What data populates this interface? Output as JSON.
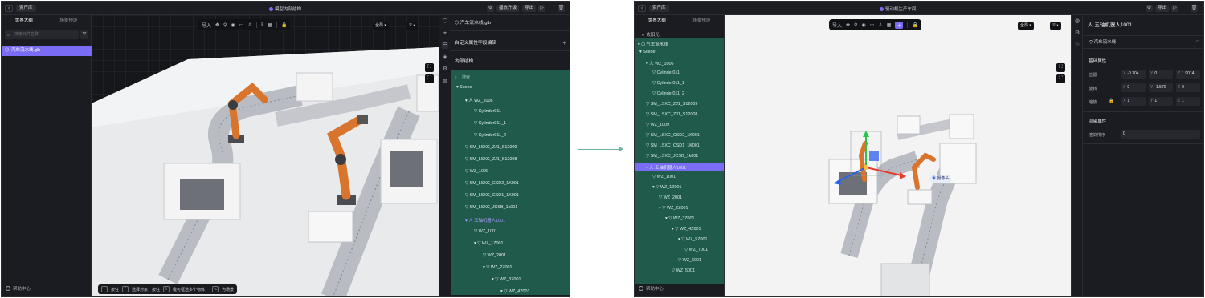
{
  "left": {
    "crumb": "资产库",
    "title": "模型内部结构",
    "top_buttons": [
      "播放升级",
      "导出"
    ],
    "tabs": [
      "世界大纲",
      "场景预设"
    ],
    "search_placeholder": "搜索元件名称",
    "file_item": "汽车流水线.glb",
    "help": "帮助中心",
    "floor_import": "导入",
    "view_mode": "全局",
    "panel_title": "汽车流水线.glb",
    "custom_attr": "自定义属性字段编辑",
    "inner_structure": "内部结构",
    "tree_search": "搜索",
    "tree": [
      {
        "label": "Scene",
        "indent": 0,
        "icon": "▾"
      },
      {
        "label": "WZ_1006",
        "indent": 1,
        "icon": "▾ 人"
      },
      {
        "label": "Cylinder011",
        "indent": 2,
        "icon": "▽"
      },
      {
        "label": "Cylinder011_1",
        "indent": 2,
        "icon": "▽"
      },
      {
        "label": "Cylinder011_2",
        "indent": 2,
        "icon": "▽"
      },
      {
        "label": "SM_LSXC_ZJ1_S12009",
        "indent": 1,
        "icon": "▽"
      },
      {
        "label": "SM_LSXC_ZJ1_S12008",
        "indent": 1,
        "icon": "▽"
      },
      {
        "label": "WZ_1009",
        "indent": 1,
        "icon": "▽"
      },
      {
        "label": "SM_LSXC_CSD2_1K001",
        "indent": 1,
        "icon": "▽"
      },
      {
        "label": "SM_LSXC_CSD1_1K001",
        "indent": 1,
        "icon": "▽"
      },
      {
        "label": "SM_LSXC_JCSB_1k001",
        "indent": 1,
        "icon": "▽"
      },
      {
        "label": "五轴机器人1001",
        "indent": 1,
        "icon": "▾ 人",
        "selected": true
      },
      {
        "label": "WZ_1001",
        "indent": 2,
        "icon": "▽"
      },
      {
        "label": "WZ_1Z001",
        "indent": 2,
        "icon": "▾ ▽"
      },
      {
        "label": "WZ_2001",
        "indent": 3,
        "icon": "▽"
      },
      {
        "label": "WZ_2Z001",
        "indent": 3,
        "icon": "▾ ▽"
      },
      {
        "label": "WZ_3Z001",
        "indent": 4,
        "icon": "▾ ▽"
      },
      {
        "label": "WZ_4Z001",
        "indent": 5,
        "icon": "▾ ▽"
      }
    ],
    "status": [
      "按住",
      "选择对象，按住",
      "键可框选多个物体，",
      "为场景"
    ]
  },
  "right": {
    "crumb": "资产库",
    "title": "驱动机生产车间",
    "top_buttons": [
      "导出"
    ],
    "tabs": [
      "世界大纲",
      "场景预设"
    ],
    "sun": "太阳光",
    "root": "汽车流水线",
    "help": "帮助中心",
    "floor_import": "导入",
    "view_mode": "全局",
    "camera_label": "摄像头",
    "tree": [
      {
        "label": "Scene",
        "indent": 0,
        "icon": "▾"
      },
      {
        "label": "WZ_1006",
        "indent": 1,
        "icon": "▾ 人"
      },
      {
        "label": "Cylinder011",
        "indent": 2,
        "icon": "▽"
      },
      {
        "label": "Cylinder011_1",
        "indent": 2,
        "icon": "▽"
      },
      {
        "label": "Cylinder011_2",
        "indent": 2,
        "icon": "▽"
      },
      {
        "label": "SM_LSXC_ZJ1_S12009",
        "indent": 1,
        "icon": "▽"
      },
      {
        "label": "SM_LSXC_ZJ1_S12008",
        "indent": 1,
        "icon": "▽"
      },
      {
        "label": "WZ_1009",
        "indent": 1,
        "icon": "▽"
      },
      {
        "label": "SM_LSXC_CSD2_1K001",
        "indent": 1,
        "icon": "▽"
      },
      {
        "label": "SM_LSXC_CSD1_1K001",
        "indent": 1,
        "icon": "▽"
      },
      {
        "label": "SM_LSXC_JCSB_1k001",
        "indent": 1,
        "icon": "▽"
      },
      {
        "label": "五轴机器人1001",
        "indent": 1,
        "icon": "▾ 人",
        "selected": true
      },
      {
        "label": "WZ_1001",
        "indent": 2,
        "icon": "▽"
      },
      {
        "label": "WZ_1Z001",
        "indent": 2,
        "icon": "▾ ▽"
      },
      {
        "label": "WZ_2001",
        "indent": 3,
        "icon": "▽"
      },
      {
        "label": "WZ_2Z001",
        "indent": 3,
        "icon": "▾ ▽"
      },
      {
        "label": "WZ_3Z001",
        "indent": 4,
        "icon": "▾ ▽"
      },
      {
        "label": "WZ_4Z001",
        "indent": 5,
        "icon": "▾ ▽"
      },
      {
        "label": "WZ_5Z001",
        "indent": 6,
        "icon": "▾ ▽"
      },
      {
        "label": "WZ_7001",
        "indent": 7,
        "icon": "▽"
      },
      {
        "label": "WZ_6001",
        "indent": 6,
        "icon": "▽"
      },
      {
        "label": "WZ_5001",
        "indent": 5,
        "icon": "▽"
      }
    ],
    "props": {
      "header": "五轴机器人1001",
      "sub": "汽车流水线",
      "basic": "基础属性",
      "position": "位置",
      "rotation": "旋转",
      "scale": "缩放",
      "render": "渲染属性",
      "render_order": "渲染排序",
      "pos_x": "-0.704",
      "pos_y": "0",
      "pos_z": "1.9014",
      "rot_x": "0",
      "rot_y": "-1.570",
      "rot_z": "0",
      "sca_x": "1",
      "sca_y": "1",
      "sca_z": "1",
      "order": "0"
    }
  },
  "colors": {
    "accent": "#7b6cf5",
    "tree_bg": "#1f5a4b",
    "arrow": "#6fb1a0"
  }
}
